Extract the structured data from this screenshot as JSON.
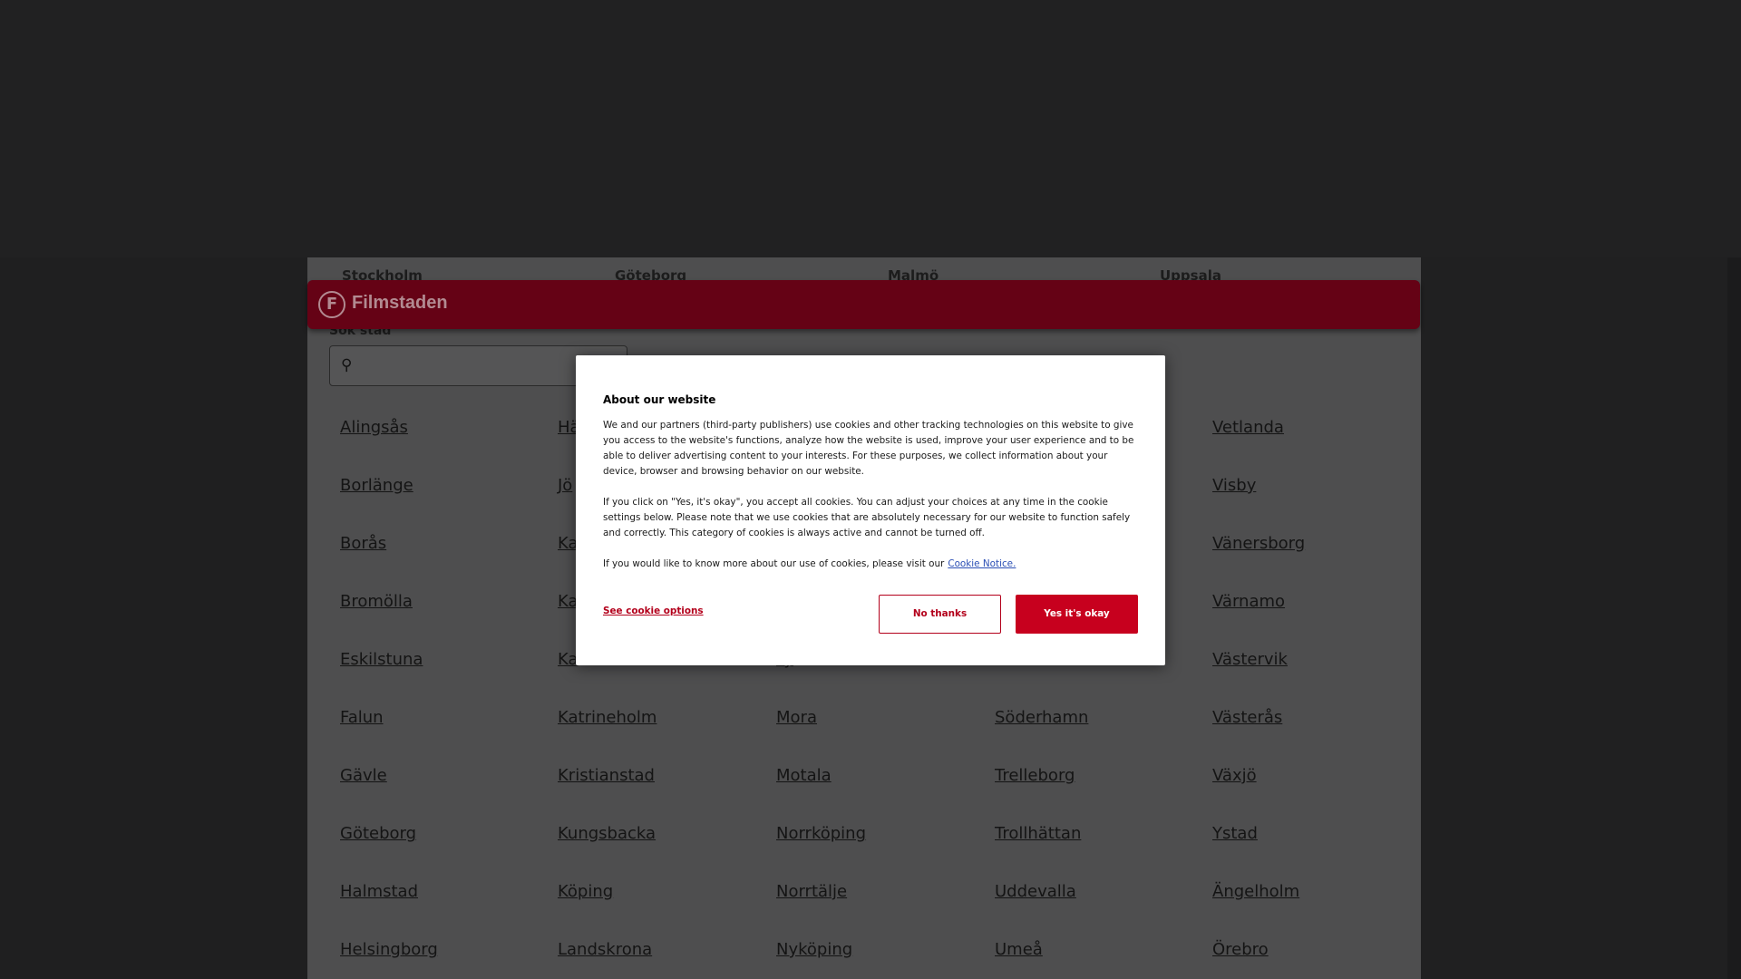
{
  "quick_cities": [
    "Stockholm",
    "Göteborg",
    "Malmö",
    "Uppsala"
  ],
  "header": {
    "logo_letter": "F",
    "brand": "Filmstaden"
  },
  "search": {
    "label": "Sök stad",
    "placeholder": ""
  },
  "cities": {
    "col1": [
      "Alingsås",
      "Borlänge",
      "Borås",
      "Bromölla",
      "Eskilstuna",
      "Falun",
      "Gävle",
      "Göteborg",
      "Halmstad",
      "Helsingborg"
    ],
    "col2": [
      "Hä",
      "Jö",
      "Ka",
      "Ka",
      "Ka",
      "Katrineholm",
      "Kristianstad",
      "Kungsbacka",
      "Köping",
      "Landskrona"
    ],
    "col3": [
      "",
      "",
      "",
      "",
      "Ly",
      "Mora",
      "Motala",
      "Norrköping",
      "Norrtälje",
      "Nyköping"
    ],
    "col4": [
      "",
      "",
      "",
      "",
      "",
      "Söderhamn",
      "Trelleborg",
      "Trollhättan",
      "Uddevalla",
      "Umeå"
    ],
    "col5": [
      "Vetlanda",
      "Visby",
      "Vänersborg",
      "Värnamo",
      "Västervik",
      "Västerås",
      "Växjö",
      "Ystad",
      "Ängelholm",
      "Örebro"
    ]
  },
  "cookie_modal": {
    "title": "About our website",
    "para1": "We and our partners (third-party publishers) use cookies and other tracking technologies on this website to give you access to the website's functions, analyze how the website is used, improve your user experience and to be able to deliver advertising content to your interests. For these purposes, we collect information about your device, browser and browsing behavior on our website.",
    "para2": "If you click on \"Yes, it's okay\", you accept all cookies. You can adjust your choices at any time in the cookie settings below. Please note that we use cookies that are absolutely necessary for our website to function safely and correctly. This category of cookies is always active and cannot be turned off.",
    "para3": "If you would like to know more about our use of cookies, please visit our",
    "link": "Cookie Notice.",
    "options": "See cookie options",
    "no": "No thanks",
    "yes": "Yes it's okay"
  },
  "colors": {
    "brand": "#650215",
    "accent": "#c7001e",
    "link": "#2b4fb5"
  }
}
